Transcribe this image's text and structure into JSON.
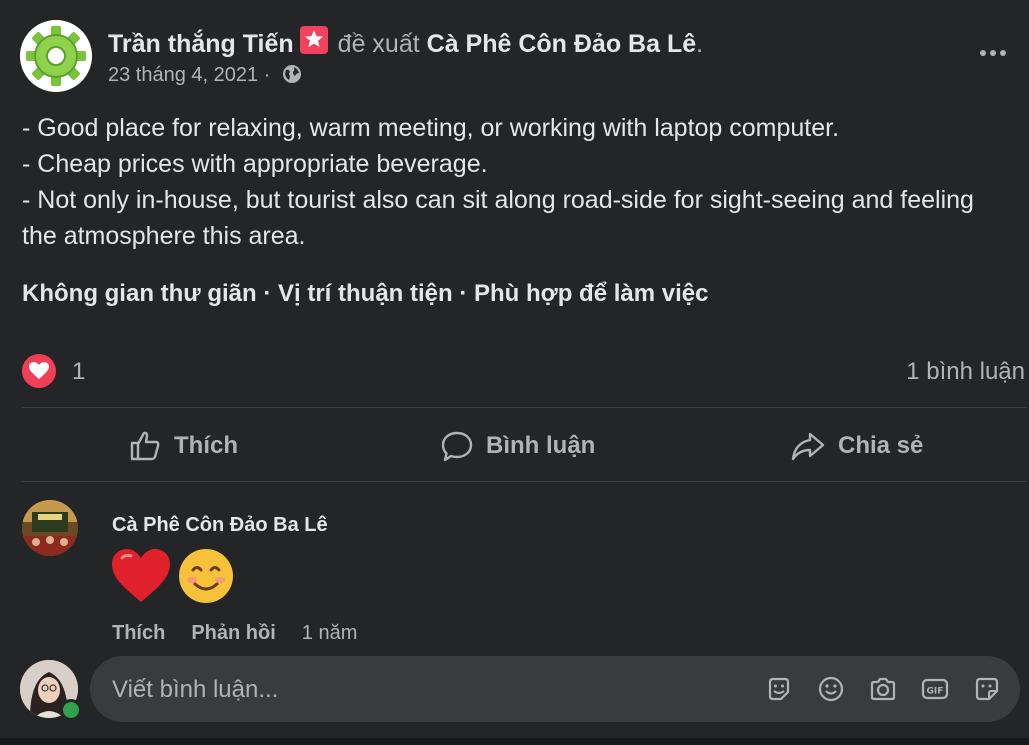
{
  "author": {
    "name": "Trần thắng Tiến",
    "recommend_text": "đề xuất",
    "page_name": "Cà Phê Côn Đảo Ba Lê",
    "period": ".",
    "date": "23 tháng 4, 2021 ·"
  },
  "body": {
    "lines": [
      "- Good place for relaxing, warm meeting, or working with laptop computer.",
      "- Cheap prices with appropriate beverage.",
      "- Not only in-house, but tourist also can sit along road-side for sight-seeing and feeling the atmosphere this area."
    ],
    "tags": "Không gian thư giãn · Vị trí thuận tiện · Phù hợp để làm việc"
  },
  "reactions": {
    "count": "1",
    "comments": "1 bình luận"
  },
  "actions": {
    "like": "Thích",
    "comment": "Bình luận",
    "share": "Chia sẻ"
  },
  "comment": {
    "author": "Cà Phê Côn Đảo Ba Lê",
    "like": "Thích",
    "reply": "Phản hồi",
    "time": "1 năm"
  },
  "composer": {
    "placeholder": "Viết bình luận..."
  },
  "colors": {
    "background": "#242526",
    "text": "#e4e6eb",
    "muted": "#b0b3b8",
    "heart": "#f33e58",
    "online": "#31a24c"
  },
  "icons": [
    "gear-avatar-icon",
    "star-badge-icon",
    "globe-icon",
    "more-icon",
    "heart-icon",
    "like-icon",
    "comment-icon",
    "share-icon",
    "sticker-icon",
    "emoji-icon",
    "camera-icon",
    "gif-icon",
    "sticker-face-icon"
  ]
}
